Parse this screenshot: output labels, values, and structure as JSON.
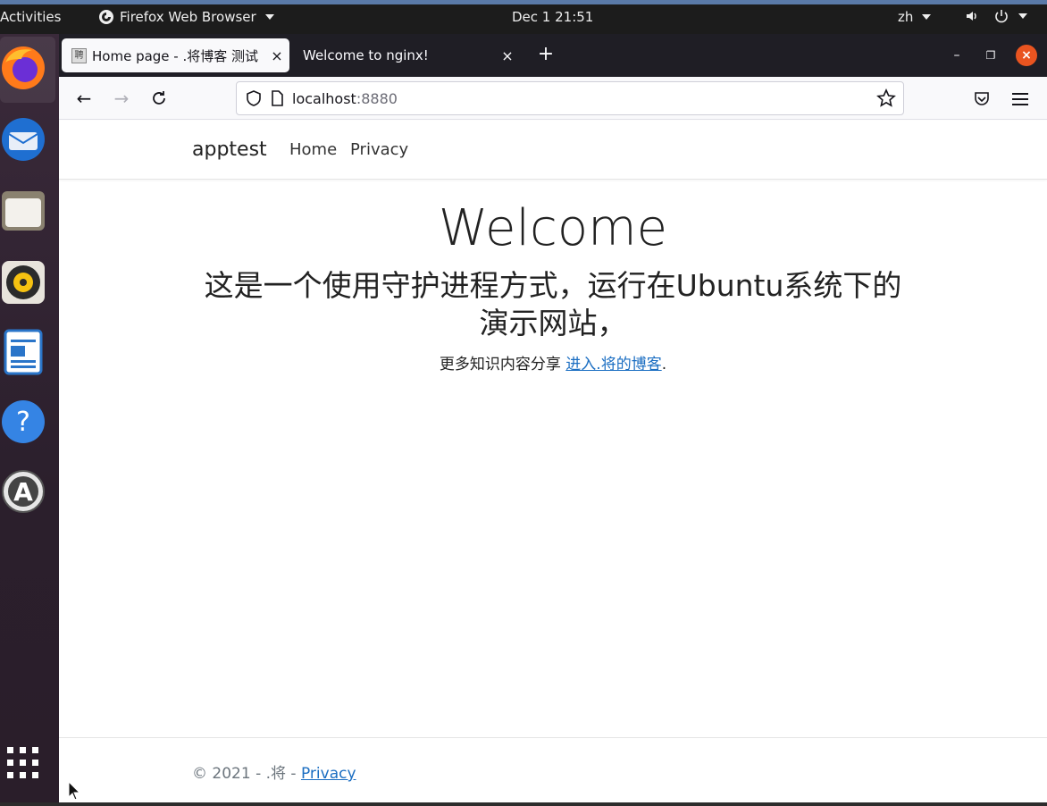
{
  "topbar": {
    "activities": "Activities",
    "app_menu": "Firefox Web Browser",
    "clock": "Dec 1  21:51",
    "lang": "zh"
  },
  "dock": {
    "items": [
      "firefox-icon",
      "thunderbird-icon",
      "files-icon",
      "rhythmbox-icon",
      "writer-icon",
      "help-icon",
      "software-icon",
      "show-apps-icon"
    ]
  },
  "browser": {
    "tabs": [
      {
        "title": "Home page - .将博客 测试",
        "favicon": "聘"
      },
      {
        "title": "Welcome to nginx!"
      }
    ],
    "url_host": "localhost",
    "url_port": ":8880"
  },
  "page": {
    "brand": "apptest",
    "nav": [
      "Home",
      "Privacy"
    ],
    "heading": "Welcome",
    "description": "这是一个使用守护进程方式，运行在Ubuntu系统下的演示网站，",
    "more_prefix": "更多知识内容分享 ",
    "more_link": "进入.将的博客",
    "more_suffix": ".",
    "footer_text": "© 2021 - .将 - ",
    "footer_link": "Privacy"
  },
  "colors": {
    "accent": "#e95420",
    "link": "#1b6ec2"
  }
}
